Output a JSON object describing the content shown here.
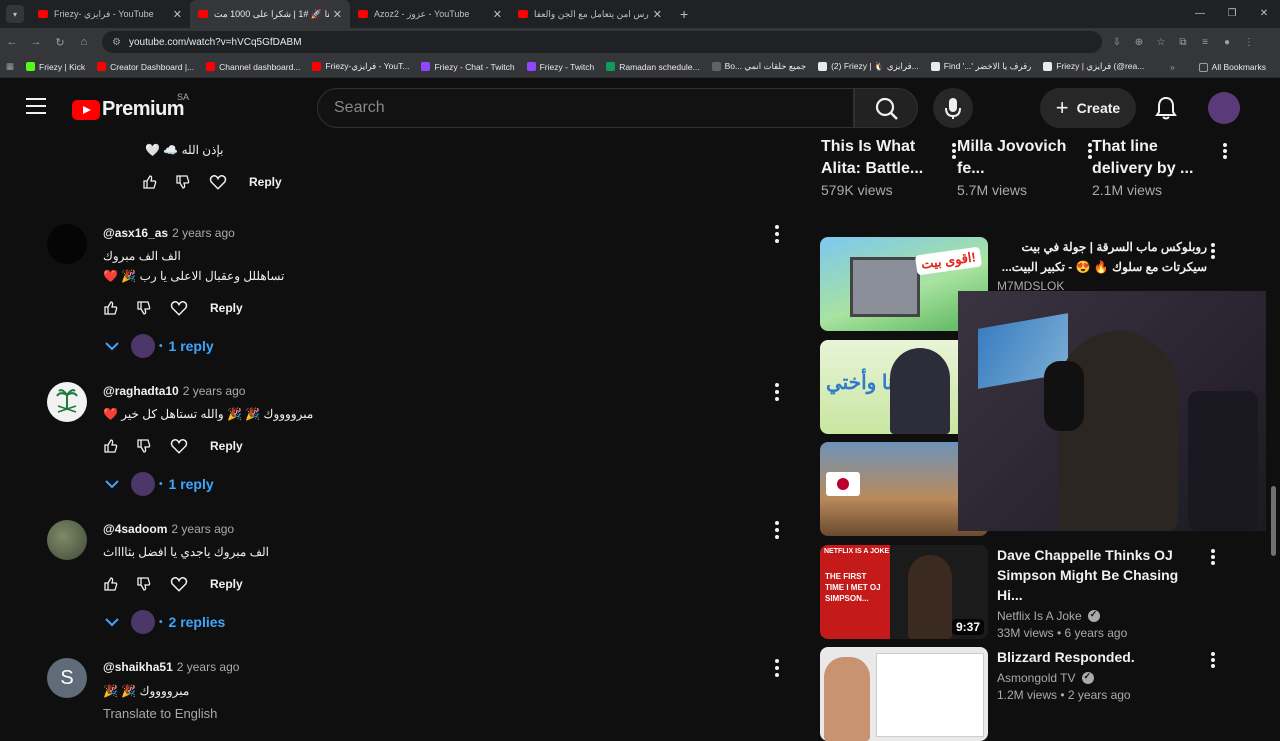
{
  "browser": {
    "tabs": [
      {
        "title": "Friezy- فرايزي - YouTube",
        "active": false
      },
      {
        "title": "وحلتنا 🚀 #1 | شكرا على 1000 مت...",
        "active": true
      },
      {
        "title": "Azoz2 - عزوز - YouTube",
        "active": false
      },
      {
        "title": "حارس امن يتعامل مع الجن والعفا...",
        "active": false
      }
    ],
    "url": "youtube.com/watch?v=hVCq5GfDABM",
    "bookmarks": [
      {
        "label": "Friezy | Kick",
        "color": "#53fc18"
      },
      {
        "label": "Creator Dashboard |...",
        "color": "#ff0000"
      },
      {
        "label": "Channel dashboard...",
        "color": "#ff0000"
      },
      {
        "label": "Friezy-فرايزي - YouT...",
        "color": "#ff0000"
      },
      {
        "label": "Friezy - Chat - Twitch",
        "color": "#9146ff"
      },
      {
        "label": "Friezy - Twitch",
        "color": "#9146ff"
      },
      {
        "label": "Ramadan schedule...",
        "color": "#0f9d58"
      },
      {
        "label": "Bo... جميع حلقات انمي",
        "color": "#5f6368"
      },
      {
        "label": "(2) Friezy | 🐧 فرايزي...",
        "color": "#e8eaed"
      },
      {
        "label": "Find '...' رفرف يا الاخضر",
        "color": "#e8eaed"
      },
      {
        "label": "Friezy | فرايزي (@rea...",
        "color": "#e8eaed"
      }
    ],
    "all_bookmarks": "All Bookmarks"
  },
  "header": {
    "logo_text": "Premium",
    "country": "SA",
    "search_placeholder": "Search",
    "create_label": "Create"
  },
  "comments": [
    {
      "author": "",
      "ago": "",
      "text": "🤍 ☁️ بإذن الله",
      "reply_label": "Reply"
    },
    {
      "author": "@asx16_as",
      "ago": "2 years ago",
      "line1": "الف الف مبروك",
      "line2": "❤️ 🎉 تساهللل وعقبال الاعلى يا رب",
      "reply_label": "Reply",
      "replies": "1 reply"
    },
    {
      "author": "@raghadta10",
      "ago": "2 years ago",
      "line1": "❤️ مبرووووك 🎉 🎉 والله تستاهل كل خير",
      "reply_label": "Reply",
      "replies": "1 reply"
    },
    {
      "author": "@4sadoom",
      "ago": "2 years ago",
      "line1": "الف مبروك ياجدي  يا افضل بثااااث",
      "reply_label": "Reply",
      "replies": "2 replies"
    },
    {
      "author": "@shaikha51",
      "ago": "2 years ago",
      "line1": "🎉 🎉 مبرووووك",
      "avatar_letter": "S",
      "translate": "Translate to English"
    }
  ],
  "side_top": [
    {
      "title": "This Is What Alita: Battle...",
      "views": "579K views"
    },
    {
      "title": "Milla Jovovich fe...",
      "views": "5.7M views"
    },
    {
      "title": "That line delivery by ...",
      "views": "2.1M views"
    }
  ],
  "side_videos": [
    {
      "title": "روبلوكس ماب السرقة | جولة في بيت سيكرتات مع سلوك 🔥 😍 - تكبير البيت...",
      "channel": "M7MDSLOK",
      "meta": "",
      "duration": "",
      "thumb_text": "اقوى بيت!"
    },
    {
      "title": "",
      "channel": "",
      "meta": "",
      "duration": "",
      "thumb_text": "أنا وأختي"
    },
    {
      "title": "",
      "channel": "",
      "meta": "",
      "duration": "",
      "thumb_text": ""
    },
    {
      "title": "Dave Chappelle Thinks OJ Simpson Might Be Chasing Hi...",
      "channel": "Netflix Is A Joke",
      "meta": "33M views • 6 years ago",
      "duration": "9:37",
      "thumb_text": "THE FIRST TIME I MET OJ SIMPSON...",
      "badge": "NETFLIX IS A JOKE"
    },
    {
      "title": "Blizzard Responded.",
      "channel": "Asmongold TV",
      "meta": "1.2M views • 2 years ago",
      "duration": "",
      "thumb_text": ""
    }
  ],
  "colors": {
    "bg": "#0f0f0f",
    "accent": "#3ea6ff",
    "brand": "#ff0000"
  }
}
